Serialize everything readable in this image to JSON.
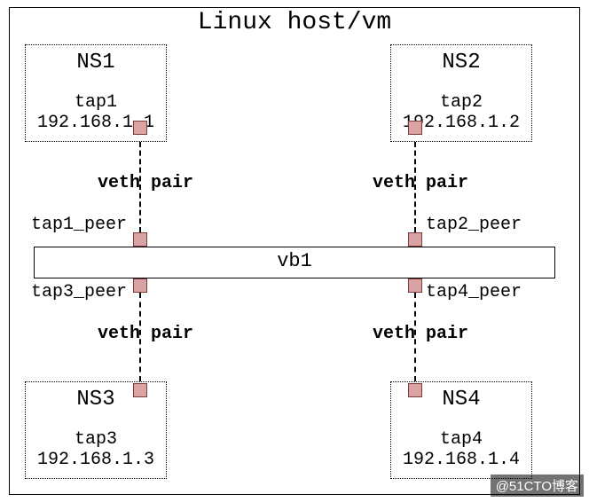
{
  "host_title": "Linux host/vm",
  "bridge": {
    "name": "vb1"
  },
  "namespaces": [
    {
      "name": "NS1",
      "tap": "tap1",
      "ip": "192.168.1.1",
      "peer": "tap1_peer"
    },
    {
      "name": "NS2",
      "tap": "tap2",
      "ip": "192.168.1.2",
      "peer": "tap2_peer"
    },
    {
      "name": "NS3",
      "tap": "tap3",
      "ip": "192.168.1.3",
      "peer": "tap3_peer"
    },
    {
      "name": "NS4",
      "tap": "tap4",
      "ip": "192.168.1.4",
      "peer": "tap4_peer"
    }
  ],
  "link_label": "veth pair",
  "watermark": "@51CTO博客"
}
